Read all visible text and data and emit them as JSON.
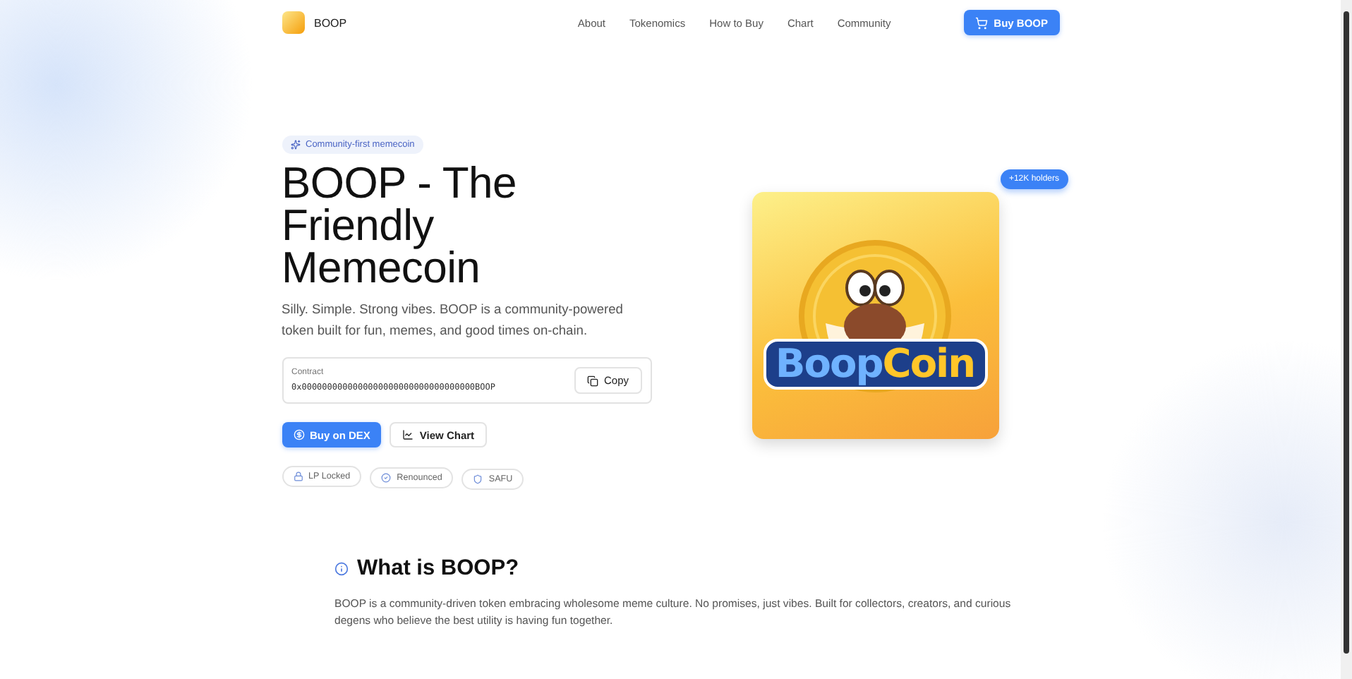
{
  "brand": {
    "name": "BOOP"
  },
  "nav": [
    {
      "label": "About"
    },
    {
      "label": "Tokenomics"
    },
    {
      "label": "How to Buy"
    },
    {
      "label": "Chart"
    },
    {
      "label": "Community"
    }
  ],
  "header_button": {
    "label": "Buy BOOP"
  },
  "hero": {
    "tag": "Community-first memecoin",
    "title": "BOOP - The Friendly Memecoin",
    "subtitle": "Silly. Simple. Strong vibes. BOOP is a community-powered token built for fun, memes, and good times on-chain.",
    "contract": {
      "label": "Contract",
      "value": "0x0000000000000000000000000000000000BOOP",
      "copy": "Copy"
    },
    "buttons": [
      {
        "label": "Buy on DEX",
        "kind": "primary"
      },
      {
        "label": "View Chart",
        "kind": "secondary"
      }
    ],
    "badges": [
      {
        "label": "LP Locked",
        "kind": "lock"
      },
      {
        "label": "Renounced",
        "kind": "check"
      },
      {
        "label": "SAFU",
        "kind": "shield"
      }
    ],
    "holders": "+12K holders",
    "art_text": [
      "Boop",
      "Coin"
    ]
  },
  "about": {
    "title": "What is BOOP?",
    "text": "BOOP is a community-driven token embracing wholesome meme culture. No promises, just vibes. Built for collectors, creators, and curious degens who believe the best utility is having fun together."
  }
}
